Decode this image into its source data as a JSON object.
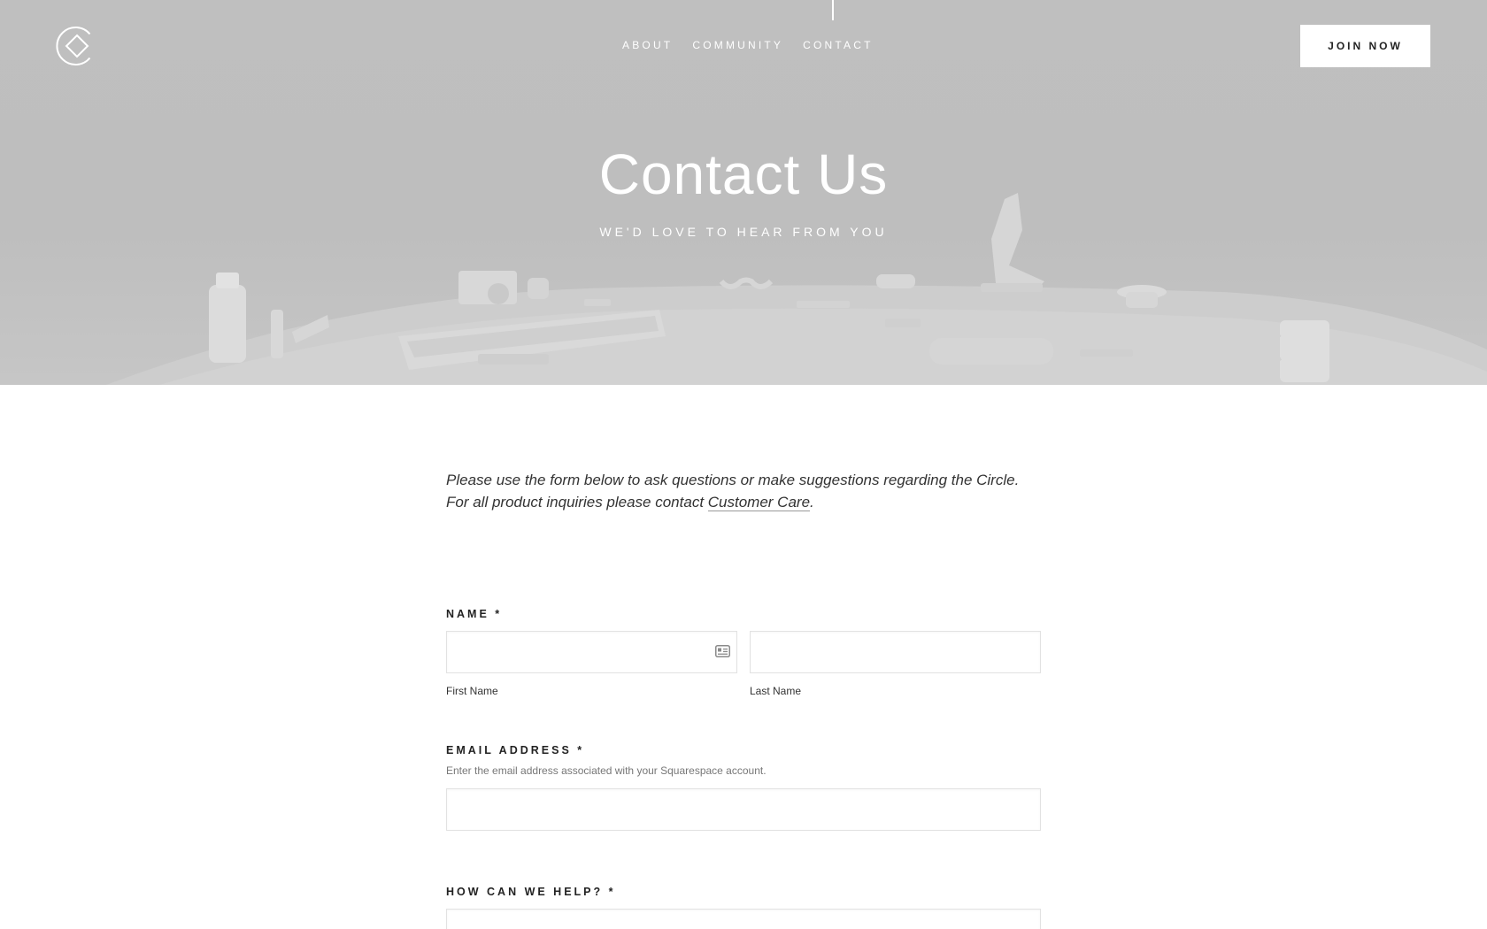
{
  "nav": {
    "links": [
      {
        "label": "ABOUT"
      },
      {
        "label": "COMMUNITY"
      },
      {
        "label": "CONTACT"
      }
    ],
    "join_label": "JOIN NOW",
    "logo_icon": "diamond-circle-logo"
  },
  "hero": {
    "title": "Contact Us",
    "subtitle": "WE'D LOVE TO HEAR FROM YOU",
    "background_color": "#bfbfbf"
  },
  "intro": {
    "text": "Please use the form below to ask questions or make suggestions regarding the Circle. For all product inquiries please contact ",
    "link_text": "Customer Care",
    "trailing": "."
  },
  "form": {
    "name": {
      "label": "NAME *",
      "first_label": "First Name",
      "last_label": "Last Name",
      "first_value": "",
      "last_value": "",
      "autofill_icon": "contact-card-icon"
    },
    "email": {
      "label": "EMAIL ADDRESS *",
      "description": "Enter the email address associated with your Squarespace account.",
      "value": ""
    },
    "help": {
      "label": "HOW CAN WE HELP? *",
      "value": ""
    }
  }
}
